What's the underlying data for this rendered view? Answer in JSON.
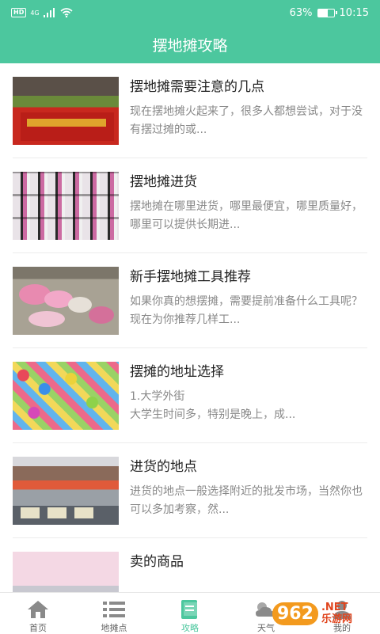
{
  "statusbar": {
    "hd": "HD",
    "network": "4G",
    "battery": "63%",
    "battery_level": 0.63,
    "time": "10:15"
  },
  "header": {
    "title": "摆地摊攻略"
  },
  "articles": [
    {
      "title": "摆地摊需要注意的几点",
      "desc": "现在摆地摊火起来了，很多人都想尝试，对于没有摆过摊的或..."
    },
    {
      "title": "摆地摊进货",
      "desc": "摆地摊在哪里进货，哪里最便宜，哪里质量好，哪里可以提供长期进..."
    },
    {
      "title": "新手摆地摊工具推荐",
      "desc": "如果你真的想摆摊，需要提前准备什么工具呢？现在为你推荐几样工..."
    },
    {
      "title": "摆摊的地址选择",
      "desc": "1.大学外街\n大学生时间多，特别是晚上，成..."
    },
    {
      "title": "进货的地点",
      "desc": "进货的地点一般选择附近的批发市场，当然你也可以多加考察，然..."
    },
    {
      "title": "卖的商品",
      "desc": ""
    }
  ],
  "tabs": [
    {
      "label": "首页",
      "icon": "home-icon"
    },
    {
      "label": "地摊点",
      "icon": "list-icon"
    },
    {
      "label": "攻略",
      "icon": "book-icon"
    },
    {
      "label": "天气",
      "icon": "weather-icon"
    },
    {
      "label": "我的",
      "icon": "user-icon"
    }
  ],
  "active_tab": "攻略",
  "colors": {
    "accent": "#4cc79e",
    "text": "#222222",
    "muted": "#888888"
  },
  "watermark": {
    "logo": "962",
    "line1": ".NET",
    "line2": "乐游网"
  }
}
